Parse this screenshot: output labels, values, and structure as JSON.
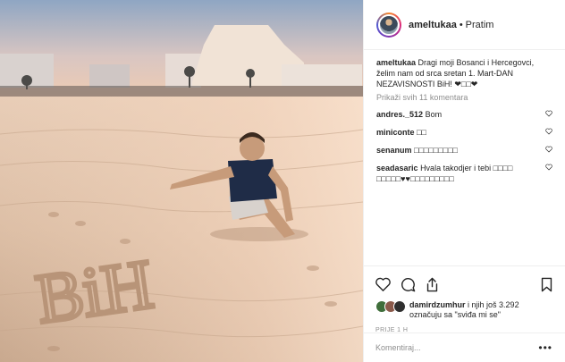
{
  "header": {
    "username": "ameltukaa",
    "separator": "•",
    "follow_label": "Pratim"
  },
  "caption": {
    "username": "ameltukaa",
    "text": "Dragi moji Bosanci i Hercegovci, želim nam od srca sretan 1. Mart-DAN NEZAVISNOSTI BiH! ❤□□❤"
  },
  "view_all_comments": "Prikaži svih 11 komentara",
  "comments": [
    {
      "username": "andres._512",
      "text": "Bom"
    },
    {
      "username": "miniconte",
      "text": "□□"
    },
    {
      "username": "senanum",
      "text": "□□□□□□□□□"
    },
    {
      "username": "seadasaric",
      "text": "Hvala takodjer i tebi □□□□ □□□□□♥♥□□□□□□□□□"
    }
  ],
  "likes": {
    "first_user": "damirdzumhur",
    "rest": "i njih još 3.292 označuju sa \"sviđa mi se\""
  },
  "timestamp": "PRIJE 1 H",
  "comment_box": {
    "placeholder": "Komentiraj..."
  },
  "photo": {
    "sand_text": "BiH"
  },
  "icons": [
    "heart-icon",
    "comment-icon",
    "share-icon",
    "bookmark-icon",
    "more-options-icon"
  ],
  "colors": {
    "text": "#262626",
    "muted": "#8e8e8e",
    "border": "#efefef"
  }
}
